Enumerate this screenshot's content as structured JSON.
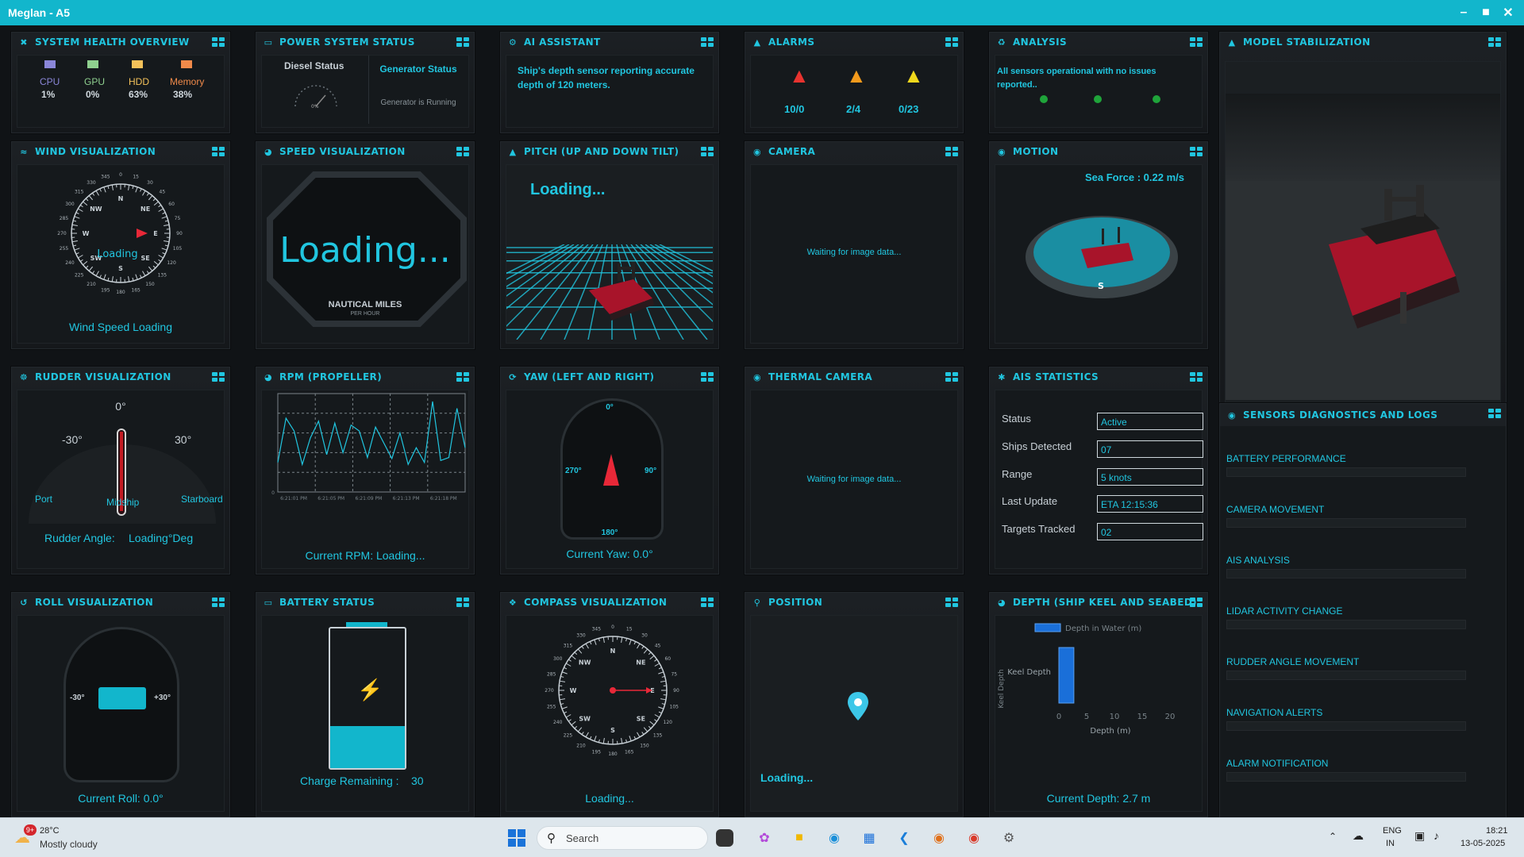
{
  "window": {
    "title": "Meglan - A5"
  },
  "panels": {
    "system_health": {
      "title": "System Health Overview",
      "metrics": [
        {
          "label": "CPU",
          "value": "1%",
          "color": "#8a86d8"
        },
        {
          "label": "GPU",
          "value": "0%",
          "color": "#8fd08f"
        },
        {
          "label": "HDD",
          "value": "63%",
          "color": "#f3c15a"
        },
        {
          "label": "Memory",
          "value": "38%",
          "color": "#f08a4a"
        }
      ]
    },
    "power": {
      "title": "Power System Status",
      "diesel_label": "Diesel Status",
      "gauge_value": "0%",
      "generator_label": "Generator Status",
      "generator_status": "Generator is Running"
    },
    "ai": {
      "title": "AI Assistant",
      "message": "Ship's depth sensor reporting accurate depth of 120 meters."
    },
    "alarms": {
      "title": "Alarms",
      "counts": [
        {
          "value": "10/0",
          "color": "#e8332f"
        },
        {
          "value": "2/4",
          "color": "#f39a1c"
        },
        {
          "value": "0/23",
          "color": "#f0d81c"
        }
      ]
    },
    "analysis": {
      "title": "Analysis",
      "message": "All sensors operational with no issues reported.."
    },
    "model": {
      "title": "Model Stabilization"
    },
    "wind": {
      "title": "Wind Visualization",
      "center": "Loading",
      "speed": "Wind Speed Loading",
      "ticks": [
        "270",
        "285",
        "300",
        "315",
        "330",
        "345",
        "0",
        "15",
        "30",
        "45",
        "60",
        "75",
        "90",
        "105",
        "120",
        "135",
        "150",
        "165",
        "180",
        "195",
        "210",
        "225",
        "240",
        "255"
      ],
      "cardinals": [
        "W",
        "NW",
        "N",
        "NE",
        "E",
        "SE",
        "S",
        "SW"
      ]
    },
    "speed": {
      "title": "Speed Visualization",
      "value": "Loading...",
      "unit": "NAUTICAL MILES",
      "sub": "PER HOUR"
    },
    "pitch": {
      "title": "Pitch (Up and Down Tilt)",
      "status": "Loading..."
    },
    "camera": {
      "title": "Camera",
      "status": "Waiting for image data..."
    },
    "motion": {
      "title": "Motion",
      "sea_force": "Sea Force : 0.22 m/s",
      "dir": "S"
    },
    "rudder": {
      "title": "Rudder Visualization",
      "left": "-30°",
      "center": "0°",
      "right": "30°",
      "port": "Port",
      "midship": "Midship",
      "starboard": "Starboard",
      "angle_label": "Rudder Angle:",
      "angle_value": "Loading°Deg"
    },
    "rpm": {
      "title": "RPM (Propeller)",
      "current": "Current RPM: Loading...",
      "x_ticks": [
        "6:21:01 PM",
        "6:21:05 PM",
        "6:21:09 PM",
        "6:21:13 PM",
        "6:21:18 PM"
      ],
      "y_ticks": [
        "",
        "",
        "",
        "",
        "",
        "0"
      ]
    },
    "yaw": {
      "title": "Yaw (Left and Right)",
      "top": "0°",
      "left": "270°",
      "right": "90°",
      "bottom": "180°",
      "current": "Current Yaw: 0.0°"
    },
    "thermal": {
      "title": "Thermal Camera",
      "status": "Waiting for image data..."
    },
    "ais": {
      "title": "AIS Statistics",
      "rows": [
        {
          "label": "Status",
          "value": "Active"
        },
        {
          "label": "Ships Detected",
          "value": "07"
        },
        {
          "label": "Range",
          "value": "5 knots"
        },
        {
          "label": "Last Update",
          "value": "ETA 12:15:36"
        },
        {
          "label": "Targets Tracked",
          "value": "02"
        }
      ]
    },
    "sensors": {
      "title": "Sensors Diagnostics and Logs",
      "items": [
        "BATTERY PERFORMANCE",
        "CAMERA MOVEMENT",
        "AIS ANALYSIS",
        "LIDAR ACTIVITY CHANGE",
        "RUDDER ANGLE MOVEMENT",
        "NAVIGATION ALERTS",
        "ALARM NOTIFICATION"
      ]
    },
    "roll": {
      "title": "Roll Visualization",
      "left": "-30°",
      "right": "+30°",
      "current": "Current Roll: 0.0°"
    },
    "battery": {
      "title": "Battery Status",
      "label": "Charge Remaining :",
      "value": "30",
      "level": 0.3
    },
    "compass": {
      "title": "Compass Visualization",
      "status": "Loading...",
      "ticks": [
        "270",
        "285",
        "300",
        "315",
        "330",
        "345",
        "0",
        "15",
        "30",
        "45",
        "60",
        "75",
        "90",
        "105",
        "120",
        "135",
        "150",
        "165",
        "180",
        "195",
        "210",
        "225",
        "240",
        "255"
      ],
      "cardinals": [
        "W",
        "NW",
        "N",
        "NE",
        "E",
        "SE",
        "S",
        "SW"
      ]
    },
    "position": {
      "title": "Position",
      "status": "Loading..."
    },
    "depth": {
      "title": "Depth (Ship Keel and Seabed)",
      "legend": "Depth in Water (m)",
      "ylabel": "Keel Depth",
      "category": "Keel Depth",
      "xlabel": "Depth (m)",
      "current": "Current Depth: 2.7 m"
    }
  },
  "chart_data": [
    {
      "type": "line",
      "title": "RPM (Propeller)",
      "x": [
        "6:21:01 PM",
        "6:21:05 PM",
        "6:21:09 PM",
        "6:21:13 PM",
        "6:21:18 PM"
      ],
      "series": [
        {
          "values": [
            0.3,
            0.75,
            0.62,
            0.28,
            0.55,
            0.72,
            0.38,
            0.7,
            0.4,
            0.68,
            0.62,
            0.35,
            0.66,
            0.5,
            0.34,
            0.6,
            0.28,
            0.45,
            0.3,
            0.92,
            0.32,
            0.35,
            0.85,
            0.45
          ]
        }
      ]
    },
    {
      "type": "bar",
      "title": "Depth (Ship Keel and Seabed)",
      "categories": [
        "Keel Depth"
      ],
      "series": [
        {
          "name": "Depth in Water (m)",
          "values": [
            2.7
          ]
        }
      ],
      "xlabel": "Depth (m)",
      "xlim": [
        0,
        20
      ],
      "x_ticks": [
        "0",
        "5",
        "10",
        "15",
        "20"
      ]
    }
  ],
  "taskbar": {
    "weather_temp": "28°C",
    "weather_desc": "Mostly cloudy",
    "weather_badge": "9+",
    "search": "Search",
    "lang": "ENG",
    "region": "IN",
    "time": "18:21",
    "date": "13-05-2025"
  }
}
